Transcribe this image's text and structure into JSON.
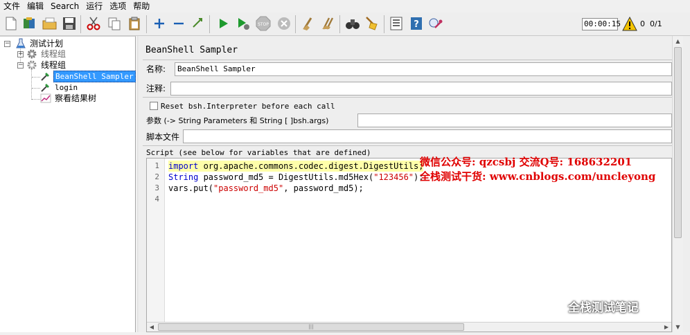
{
  "menu": [
    "文件",
    "编辑",
    "Search",
    "运行",
    "选项",
    "帮助"
  ],
  "toolbar": {
    "timer": "00:00:15",
    "error_count": "0",
    "thread_count": "0/1"
  },
  "tree": {
    "root": "测试计划",
    "group1": "线程组",
    "group2": "线程组",
    "sampler1": "BeanShell Sampler",
    "sampler2": "login",
    "listener": "察看结果树"
  },
  "panel": {
    "title": "BeanShell Sampler",
    "name_label": "名称:",
    "name_value": "BeanShell Sampler",
    "comment_label": "注释:",
    "comment_value": "",
    "reset_label": "Reset bsh.Interpreter before each call",
    "reset_checked": false,
    "params_label": "参数 (-> String Parameters 和 String [ ]bsh.args)",
    "params_value": "",
    "script_file_label": "脚本文件",
    "script_file_value": "",
    "script_label": "Script (see below for variables that are defined)"
  },
  "script": {
    "line_numbers": [
      "1",
      "2",
      "3",
      "4"
    ],
    "line1_kw": "import",
    "line1_rest": " org.apache.commons.codec.digest.DigestUtils;",
    "line2_kw": "String",
    "line2_mid": " password_md5 = DigestUtils.md5Hex(",
    "line2_str": "\"123456\"",
    "line2_end": ");",
    "line3_start": "vars.put(",
    "line3_str": "\"password_md5\"",
    "line3_end": ", password_md5);"
  },
  "watermark": {
    "line1": "微信公众号: qzcsbj    交流Q号: 168632201",
    "line2": "全栈测试干货: www.cnblogs.com/uncleyong",
    "brand": "全栈测试笔记"
  },
  "colors": {
    "selection": "#3399ff",
    "keyword": "#0000cc",
    "string": "#cc0000",
    "watermark_red": "#e00000"
  }
}
